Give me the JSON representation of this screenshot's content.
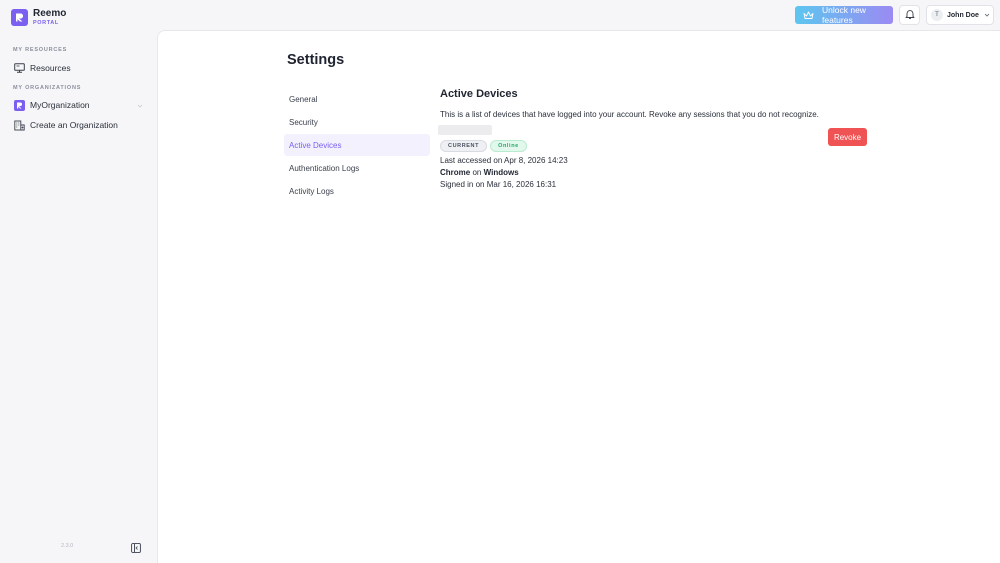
{
  "brand": {
    "name": "Reemo",
    "subtitle": "PORTAL",
    "accent": "#7b5ff0"
  },
  "sidebar": {
    "resources_label": "MY RESOURCES",
    "resources_items": [
      {
        "label": "Resources",
        "icon": "monitor-icon"
      }
    ],
    "organizations_label": "MY ORGANIZATIONS",
    "organization_items": [
      {
        "label": "MyOrganization",
        "icon": "org-logo-icon"
      },
      {
        "label": "Create an Organization",
        "icon": "building-add-icon"
      }
    ],
    "version": "2.3.0"
  },
  "topbar": {
    "unlock_label": "Unlock new features",
    "user_initial": "T",
    "user_name": "John Doe"
  },
  "page": {
    "title": "Settings",
    "nav": [
      {
        "label": "General",
        "active": false
      },
      {
        "label": "Security",
        "active": false
      },
      {
        "label": "Active Devices",
        "active": true
      },
      {
        "label": "Authentication Logs",
        "active": false
      },
      {
        "label": "Activity Logs",
        "active": false
      }
    ]
  },
  "devices": {
    "title": "Active Devices",
    "description": "This is a list of devices that have logged into your account. Revoke any sessions that you do not recognize.",
    "items": [
      {
        "badge_current": "CURRENT",
        "badge_status": "Online",
        "last_accessed": "Last accessed on Apr 8, 2026 14:23",
        "browser": "Chrome",
        "on_text": "on",
        "os": "Windows",
        "signed_in": "Signed in on Mar 16, 2026 16:31",
        "revoke_label": "Revoke"
      }
    ]
  },
  "colors": {
    "revoke": "#ef5353",
    "online": "#22a564",
    "active_nav": "#7b5ff0"
  }
}
